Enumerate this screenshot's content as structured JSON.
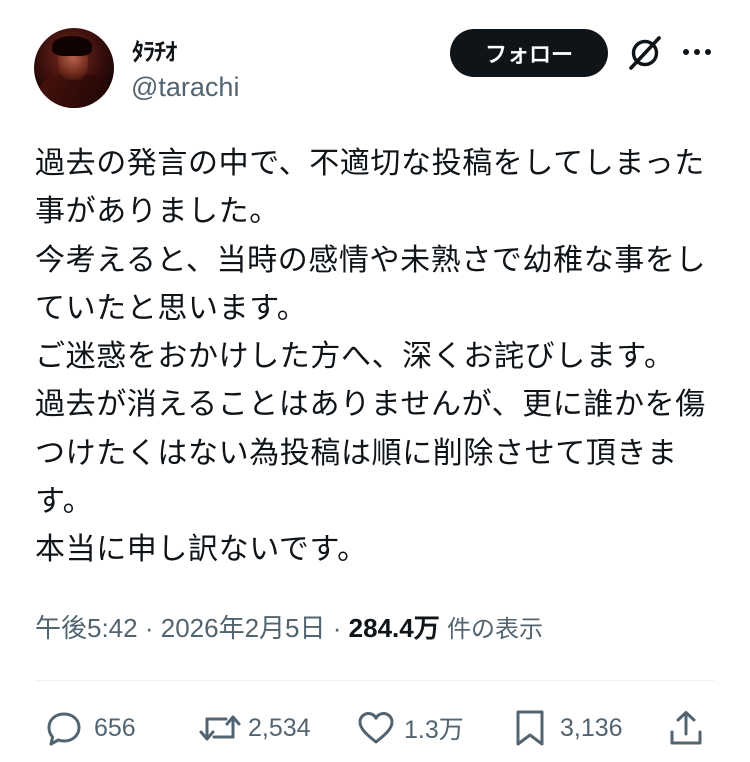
{
  "header": {
    "display_name": "ﾀﾗﾁｵ",
    "handle": "@tarachi",
    "follow_label": "フォロー"
  },
  "tweet": {
    "text": "過去の発言の中で、不適切な投稿をしてしまった事がありました。\n今考えると、当時の感情や未熟さで幼稚な事をしていたと思います。\nご迷惑をおかけした方へ、深くお詫びします。\n過去が消えることはありませんが、更に誰かを傷つけたくはない為投稿は順に削除させて頂きます。\n本当に申し訳ないです。"
  },
  "meta": {
    "time": "午後5:42",
    "separator": "·",
    "date": "2026年2月5日",
    "views_count": "284.4万",
    "views_label": "件の表示"
  },
  "actions": {
    "replies": "656",
    "reposts": "2,534",
    "likes": "1.3万",
    "bookmarks": "3,136"
  },
  "icons": {
    "grok": "grok-icon",
    "more": "more-icon",
    "reply": "reply-icon",
    "repost": "repost-icon",
    "like": "heart-icon",
    "bookmark": "bookmark-icon",
    "share": "share-icon"
  },
  "colors": {
    "text": "#0f1419",
    "secondary": "#536471",
    "follow_bg": "#0f1419",
    "divider": "#eff3f4"
  }
}
